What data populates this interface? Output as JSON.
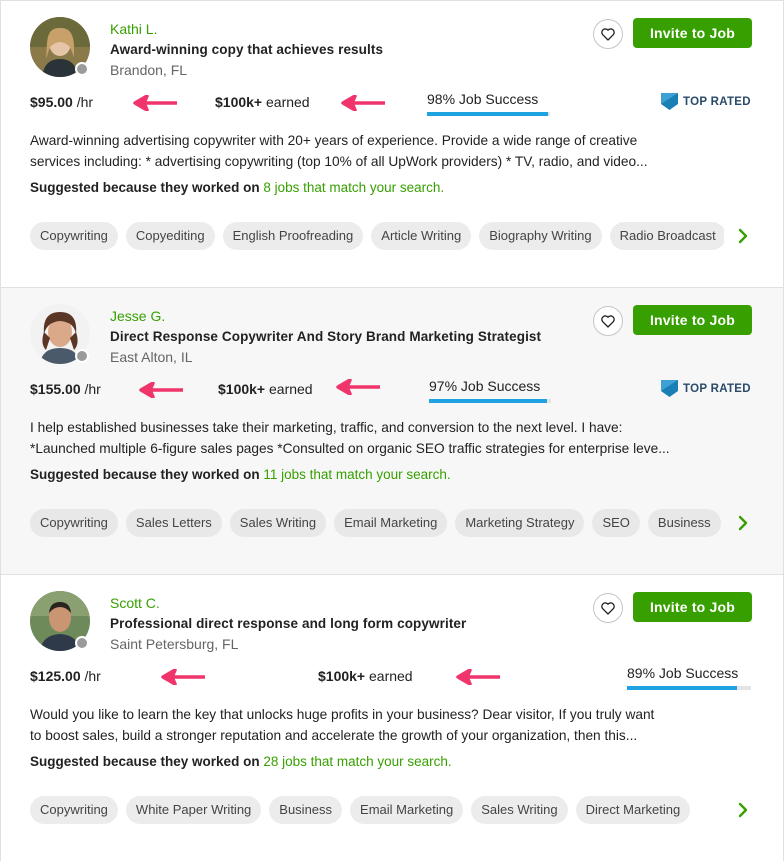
{
  "colors": {
    "brand": "#37a000",
    "arrow": "#f0346c",
    "jss_bar": "#1ea3e0",
    "top_rated_badge": "#1a7fb5"
  },
  "cards": [
    {
      "name": "Kathi L.",
      "title": "Award-winning copy that achieves results",
      "location": "Brandon, FL",
      "invite_label": "Invite to Job",
      "rate": "$95.00",
      "rate_unit": "/hr",
      "earned": "$100k+",
      "earned_label": "earned",
      "job_success": "98% Job Success",
      "job_success_pct": 98,
      "top_rated": "TOP RATED",
      "description": [
        "Award-winning advertising copywriter with 20+ years of experience. Provide a wide range of creative",
        "services including: * advertising copywriting (top 10% of all UpWork providers) * TV, radio, and video..."
      ],
      "suggest_prefix": "Suggested because they worked on",
      "suggest_link": "8 jobs that match your search.",
      "skills": [
        "Copywriting",
        "Copyediting",
        "English Proofreading",
        "Article Writing",
        "Biography Writing",
        "Radio Broadcast"
      ]
    },
    {
      "name": "Jesse G.",
      "title": "Direct Response Copywriter And Story Brand Marketing Strategist",
      "location": "East Alton, IL",
      "invite_label": "Invite to Job",
      "rate": "$155.00",
      "rate_unit": "/hr",
      "earned": "$100k+",
      "earned_label": "earned",
      "job_success": "97% Job Success",
      "job_success_pct": 97,
      "top_rated": "TOP RATED",
      "description": [
        "I help established businesses take their marketing, traffic, and conversion to the next level. I have:",
        "*Launched multiple 6-figure sales pages *Consulted on organic SEO traffic strategies for enterprise leve..."
      ],
      "suggest_prefix": "Suggested because they worked on",
      "suggest_link": "11 jobs that match your search.",
      "skills": [
        "Copywriting",
        "Sales Letters",
        "Sales Writing",
        "Email Marketing",
        "Marketing Strategy",
        "SEO",
        "Business"
      ]
    },
    {
      "name": "Scott C.",
      "title": "Professional direct response and long form copywriter",
      "location": "Saint Petersburg, FL",
      "invite_label": "Invite to Job",
      "rate": "$125.00",
      "rate_unit": "/hr",
      "earned": "$100k+",
      "earned_label": "earned",
      "job_success": "89% Job Success",
      "job_success_pct": 89,
      "top_rated": "",
      "description": [
        "Would you like to learn the key that unlocks huge profits in your business? Dear visitor, If you truly want",
        "to boost sales, build a stronger reputation and accelerate the growth of your organization, then this..."
      ],
      "suggest_prefix": "Suggested because they worked on",
      "suggest_link": "28 jobs that match your search.",
      "skills": [
        "Copywriting",
        "White Paper Writing",
        "Business",
        "Email Marketing",
        "Sales Writing",
        "Direct Marketing"
      ]
    }
  ]
}
